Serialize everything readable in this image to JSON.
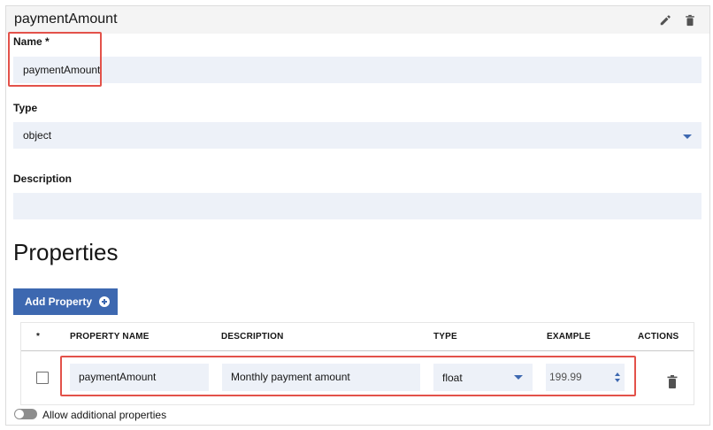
{
  "header": {
    "title": "paymentAmount",
    "edit_icon": "pencil-icon",
    "delete_icon": "trash-icon"
  },
  "form": {
    "name_label": "Name *",
    "name_value": "paymentAmount",
    "type_label": "Type",
    "type_value": "object",
    "description_label": "Description",
    "description_value": ""
  },
  "properties": {
    "title": "Properties",
    "add_button_label": "Add Property",
    "add_button_icon": "add-circle-icon",
    "columns": {
      "required": "*",
      "name": "PROPERTY NAME",
      "description": "DESCRIPTION",
      "type": "TYPE",
      "example": "EXAMPLE",
      "actions": "ACTIONS"
    },
    "rows": [
      {
        "required": false,
        "name": "paymentAmount",
        "description": "Monthly payment amount",
        "type": "float",
        "example": "199.99"
      }
    ],
    "allow_additional_label": "Allow additional properties",
    "allow_additional_enabled": false
  },
  "colors": {
    "accent": "#3d68b0",
    "input_bg": "#edf1f8",
    "highlight": "#e3524a",
    "header_bg": "#f4f4f4"
  }
}
